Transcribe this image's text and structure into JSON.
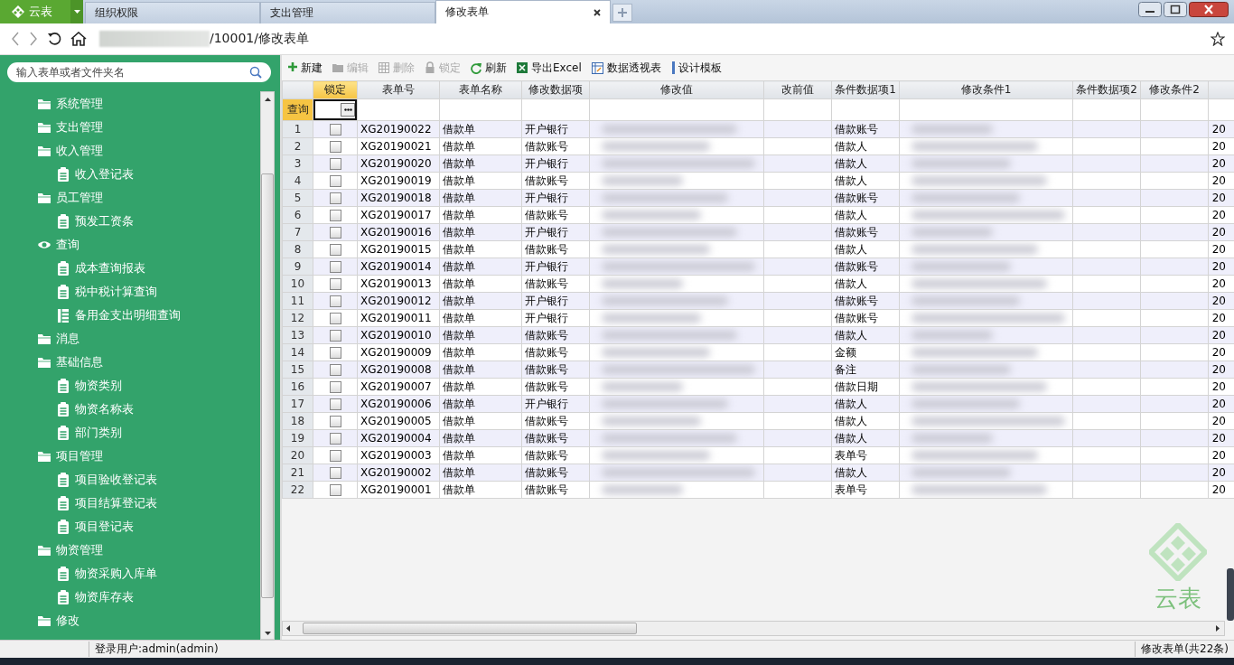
{
  "app_menu": {
    "label": "云表"
  },
  "tabs": [
    {
      "label": "组织权限",
      "selected": false
    },
    {
      "label": "支出管理",
      "selected": false
    },
    {
      "label": "修改表单",
      "selected": true
    }
  ],
  "address": {
    "path": "/10001/修改表单"
  },
  "search": {
    "placeholder": "输入表单或者文件夹名"
  },
  "sidebar": {
    "items": [
      {
        "label": "系统管理",
        "kind": "folder"
      },
      {
        "label": "支出管理",
        "kind": "folder"
      },
      {
        "label": "收入管理",
        "kind": "folder",
        "children": [
          {
            "label": "收入登记表",
            "kind": "form"
          }
        ]
      },
      {
        "label": "员工管理",
        "kind": "folder",
        "children": [
          {
            "label": "预发工资条",
            "kind": "form"
          }
        ]
      },
      {
        "label": "查询",
        "kind": "view",
        "children": [
          {
            "label": "成本查询报表",
            "kind": "form"
          },
          {
            "label": "税中税计算查询",
            "kind": "form"
          },
          {
            "label": "备用金支出明细查询",
            "kind": "list"
          }
        ]
      },
      {
        "label": "消息",
        "kind": "folder"
      },
      {
        "label": "基础信息",
        "kind": "folder",
        "children": [
          {
            "label": "物资类别",
            "kind": "form"
          },
          {
            "label": "物资名称表",
            "kind": "form"
          },
          {
            "label": "部门类别",
            "kind": "form"
          }
        ]
      },
      {
        "label": "项目管理",
        "kind": "folder",
        "children": [
          {
            "label": "项目验收登记表",
            "kind": "form"
          },
          {
            "label": "项目结算登记表",
            "kind": "form"
          },
          {
            "label": "项目登记表",
            "kind": "form"
          }
        ]
      },
      {
        "label": "物资管理",
        "kind": "folder",
        "children": [
          {
            "label": "物资采购入库单",
            "kind": "form"
          },
          {
            "label": "物资库存表",
            "kind": "form"
          }
        ]
      },
      {
        "label": "修改",
        "kind": "folder"
      }
    ]
  },
  "toolbar": [
    {
      "label": "新建",
      "kind": "add",
      "disabled": false
    },
    {
      "label": "编辑",
      "kind": "edit",
      "disabled": true
    },
    {
      "label": "删除",
      "kind": "delete",
      "disabled": true
    },
    {
      "label": "锁定",
      "kind": "lock",
      "disabled": true
    },
    {
      "label": "刷新",
      "kind": "refresh",
      "disabled": false
    },
    {
      "label": "导出Excel",
      "kind": "export",
      "disabled": false
    },
    {
      "label": "数据透视表",
      "kind": "pivot",
      "disabled": false
    },
    {
      "label": "设计模板",
      "kind": "template",
      "disabled": false
    }
  ],
  "table": {
    "columns": [
      {
        "label": "锁定",
        "selected": true
      },
      {
        "label": "表单号",
        "selected": false
      },
      {
        "label": "表单名称",
        "selected": false
      },
      {
        "label": "修改数据项",
        "selected": false
      },
      {
        "label": "修改值",
        "selected": false
      },
      {
        "label": "改前值",
        "selected": false
      },
      {
        "label": "条件数据项1",
        "selected": false
      },
      {
        "label": "修改条件1",
        "selected": false
      },
      {
        "label": "条件数据项2",
        "selected": false
      },
      {
        "label": "修改条件2",
        "selected": false
      }
    ],
    "query_label": "查询",
    "rows": [
      {
        "number": "1",
        "locked": false,
        "form_no": "XG20190022",
        "form_name": "借款单",
        "field": "开户银行",
        "condition_field_1": "借款账号",
        "column_12": "20"
      },
      {
        "number": "2",
        "locked": false,
        "form_no": "XG20190021",
        "form_name": "借款单",
        "field": "借款账号",
        "condition_field_1": "借款人",
        "column_12": "20"
      },
      {
        "number": "3",
        "locked": false,
        "form_no": "XG20190020",
        "form_name": "借款单",
        "field": "开户银行",
        "condition_field_1": "借款人",
        "column_12": "20"
      },
      {
        "number": "4",
        "locked": false,
        "form_no": "XG20190019",
        "form_name": "借款单",
        "field": "借款账号",
        "condition_field_1": "借款人",
        "column_12": "20"
      },
      {
        "number": "5",
        "locked": false,
        "form_no": "XG20190018",
        "form_name": "借款单",
        "field": "开户银行",
        "condition_field_1": "借款账号",
        "column_12": "20"
      },
      {
        "number": "6",
        "locked": false,
        "form_no": "XG20190017",
        "form_name": "借款单",
        "field": "借款账号",
        "condition_field_1": "借款人",
        "column_12": "20"
      },
      {
        "number": "7",
        "locked": false,
        "form_no": "XG20190016",
        "form_name": "借款单",
        "field": "开户银行",
        "condition_field_1": "借款账号",
        "column_12": "20"
      },
      {
        "number": "8",
        "locked": false,
        "form_no": "XG20190015",
        "form_name": "借款单",
        "field": "借款账号",
        "condition_field_1": "借款人",
        "column_12": "20"
      },
      {
        "number": "9",
        "locked": false,
        "form_no": "XG20190014",
        "form_name": "借款单",
        "field": "开户银行",
        "condition_field_1": "借款账号",
        "column_12": "20"
      },
      {
        "number": "10",
        "locked": false,
        "form_no": "XG20190013",
        "form_name": "借款单",
        "field": "借款账号",
        "condition_field_1": "借款人",
        "column_12": "20"
      },
      {
        "number": "11",
        "locked": false,
        "form_no": "XG20190012",
        "form_name": "借款单",
        "field": "开户银行",
        "condition_field_1": "借款账号",
        "column_12": "20"
      },
      {
        "number": "12",
        "locked": false,
        "form_no": "XG20190011",
        "form_name": "借款单",
        "field": "开户银行",
        "condition_field_1": "借款账号",
        "column_12": "20"
      },
      {
        "number": "13",
        "locked": false,
        "form_no": "XG20190010",
        "form_name": "借款单",
        "field": "借款账号",
        "condition_field_1": "借款人",
        "column_12": "20"
      },
      {
        "number": "14",
        "locked": false,
        "form_no": "XG20190009",
        "form_name": "借款单",
        "field": "借款账号",
        "condition_field_1": "金额",
        "column_12": "20"
      },
      {
        "number": "15",
        "locked": false,
        "form_no": "XG20190008",
        "form_name": "借款单",
        "field": "借款账号",
        "condition_field_1": "备注",
        "column_12": "20"
      },
      {
        "number": "16",
        "locked": false,
        "form_no": "XG20190007",
        "form_name": "借款单",
        "field": "借款账号",
        "condition_field_1": "借款日期",
        "column_12": "20"
      },
      {
        "number": "17",
        "locked": false,
        "form_no": "XG20190006",
        "form_name": "借款单",
        "field": "开户银行",
        "condition_field_1": "借款人",
        "column_12": "20"
      },
      {
        "number": "18",
        "locked": false,
        "form_no": "XG20190005",
        "form_name": "借款单",
        "field": "借款账号",
        "condition_field_1": "借款人",
        "column_12": "20"
      },
      {
        "number": "19",
        "locked": false,
        "form_no": "XG20190004",
        "form_name": "借款单",
        "field": "借款账号",
        "condition_field_1": "借款人",
        "column_12": "20"
      },
      {
        "number": "20",
        "locked": false,
        "form_no": "XG20190003",
        "form_name": "借款单",
        "field": "借款账号",
        "condition_field_1": "表单号",
        "column_12": "20"
      },
      {
        "number": "21",
        "locked": false,
        "form_no": "XG20190002",
        "form_name": "借款单",
        "field": "借款账号",
        "condition_field_1": "借款人",
        "column_12": "20"
      },
      {
        "number": "22",
        "locked": false,
        "form_no": "XG20190001",
        "form_name": "借款单",
        "field": "借款账号",
        "condition_field_1": "表单号",
        "column_12": "20"
      }
    ]
  },
  "logo": {
    "label": "云表"
  },
  "status_bar": {
    "user": "登录用户:admin(admin)",
    "summary": "修改表单(共22条)"
  }
}
